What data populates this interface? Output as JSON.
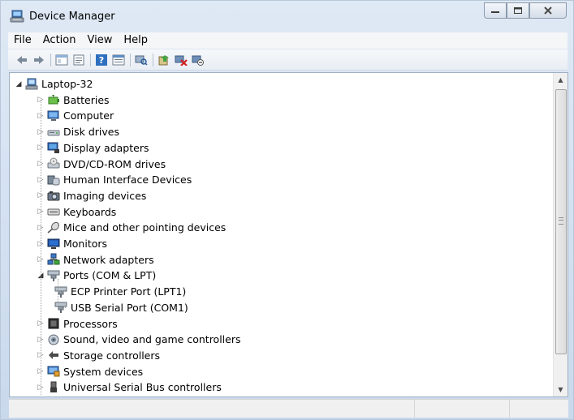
{
  "window": {
    "title": "Device Manager"
  },
  "menu": [
    "File",
    "Action",
    "View",
    "Help"
  ],
  "toolbar": {
    "buttons": [
      "back-icon",
      "forward-icon",
      "show-hide-tree-icon",
      "properties-icon",
      "help-icon",
      "view-icon",
      "scan-hardware-icon",
      "update-driver-icon",
      "uninstall-icon",
      "disable-icon"
    ]
  },
  "tree": {
    "root": "Laptop-32",
    "items": [
      {
        "label": "Batteries",
        "icon": "battery-icon",
        "expanded": false
      },
      {
        "label": "Computer",
        "icon": "computer-icon",
        "expanded": false
      },
      {
        "label": "Disk drives",
        "icon": "disk-drive-icon",
        "expanded": false
      },
      {
        "label": "Display adapters",
        "icon": "display-adapter-icon",
        "expanded": false
      },
      {
        "label": "DVD/CD-ROM drives",
        "icon": "dvd-drive-icon",
        "expanded": false
      },
      {
        "label": "Human Interface Devices",
        "icon": "hid-icon",
        "expanded": false
      },
      {
        "label": "Imaging devices",
        "icon": "camera-icon",
        "expanded": false
      },
      {
        "label": "Keyboards",
        "icon": "keyboard-icon",
        "expanded": false
      },
      {
        "label": "Mice and other pointing devices",
        "icon": "mouse-icon",
        "expanded": false
      },
      {
        "label": "Monitors",
        "icon": "monitor-icon",
        "expanded": false
      },
      {
        "label": "Network adapters",
        "icon": "network-icon",
        "expanded": false
      },
      {
        "label": "Ports (COM & LPT)",
        "icon": "port-icon",
        "expanded": true,
        "children": [
          "ECP Printer Port (LPT1)",
          "USB Serial Port (COM1)"
        ]
      },
      {
        "label": "Processors",
        "icon": "processor-icon",
        "expanded": false
      },
      {
        "label": "Sound, video and game controllers",
        "icon": "sound-icon",
        "expanded": false
      },
      {
        "label": "Storage controllers",
        "icon": "storage-icon",
        "expanded": false
      },
      {
        "label": "System devices",
        "icon": "system-icon",
        "expanded": false
      },
      {
        "label": "Universal Serial Bus controllers",
        "icon": "usb-icon",
        "expanded": false
      }
    ]
  },
  "colors": {
    "frame": "#c9d9ec",
    "selection_accent": "#3b6ea5"
  }
}
